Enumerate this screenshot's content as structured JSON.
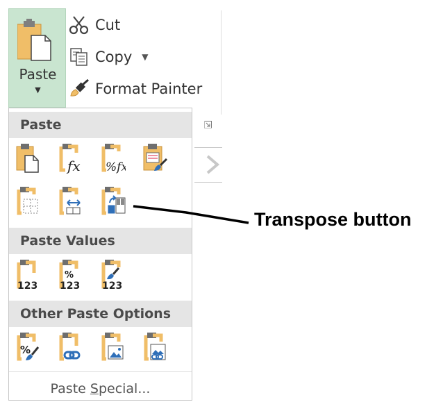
{
  "ribbon": {
    "paste_label": "Paste",
    "cut_label": "Cut",
    "copy_label": "Copy",
    "format_painter_label": "Format Painter"
  },
  "menu": {
    "paste_header": "Paste",
    "paste_values_header": "Paste Values",
    "other_paste_options_header": "Other Paste Options",
    "paste_special_label": "Paste Special...",
    "paste_special_prefix": "Paste ",
    "paste_special_accel": "S",
    "paste_special_suffix": "pecial..."
  },
  "icon_labels": {
    "formulas": "fx",
    "formulas_format": "%fx",
    "values": "123",
    "percent": "%"
  },
  "annotation": {
    "text": "Transpose button"
  },
  "colors": {
    "clipboard": "#f0be68",
    "paste_button_bg": "#c9e5d0",
    "header_bg": "#e5e5e5",
    "icon_blue": "#2f6fb8"
  }
}
